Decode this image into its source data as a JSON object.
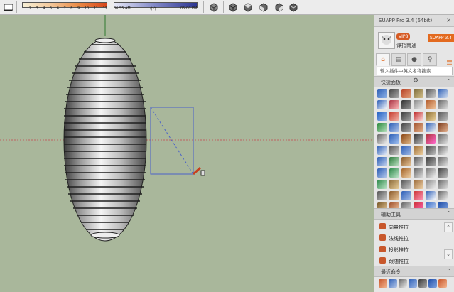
{
  "toolbar": {
    "month_ticks": [
      "1",
      "2",
      "3",
      "4",
      "5",
      "6",
      "7",
      "8",
      "9",
      "10",
      "11",
      "12"
    ],
    "time_start": "06:55 AM",
    "time_mid": "中午",
    "time_end": "05:00 PM"
  },
  "panel": {
    "title": "SUAPP Pro 3.4 (64bit)",
    "close": "×",
    "vip_badge": "VIP8",
    "version_badge": "SUAPP 3.4",
    "username": "谭指南通",
    "search_placeholder": "输入插件中英文名称搜索",
    "tabs": [
      {
        "name": "home",
        "glyph": "⌂"
      },
      {
        "name": "docs",
        "glyph": "▤"
      },
      {
        "name": "user",
        "glyph": "●"
      },
      {
        "name": "search",
        "glyph": "⚲"
      }
    ],
    "sections": {
      "quick": "快捷面板",
      "aux": "辅助工具",
      "recent": "最近命令"
    },
    "aux_items": [
      "向量推拉",
      "法线推拉",
      "投影推拉",
      "跟随推拉"
    ]
  },
  "accent": "#e06a1f",
  "viewport_bg": "#a9b79b"
}
